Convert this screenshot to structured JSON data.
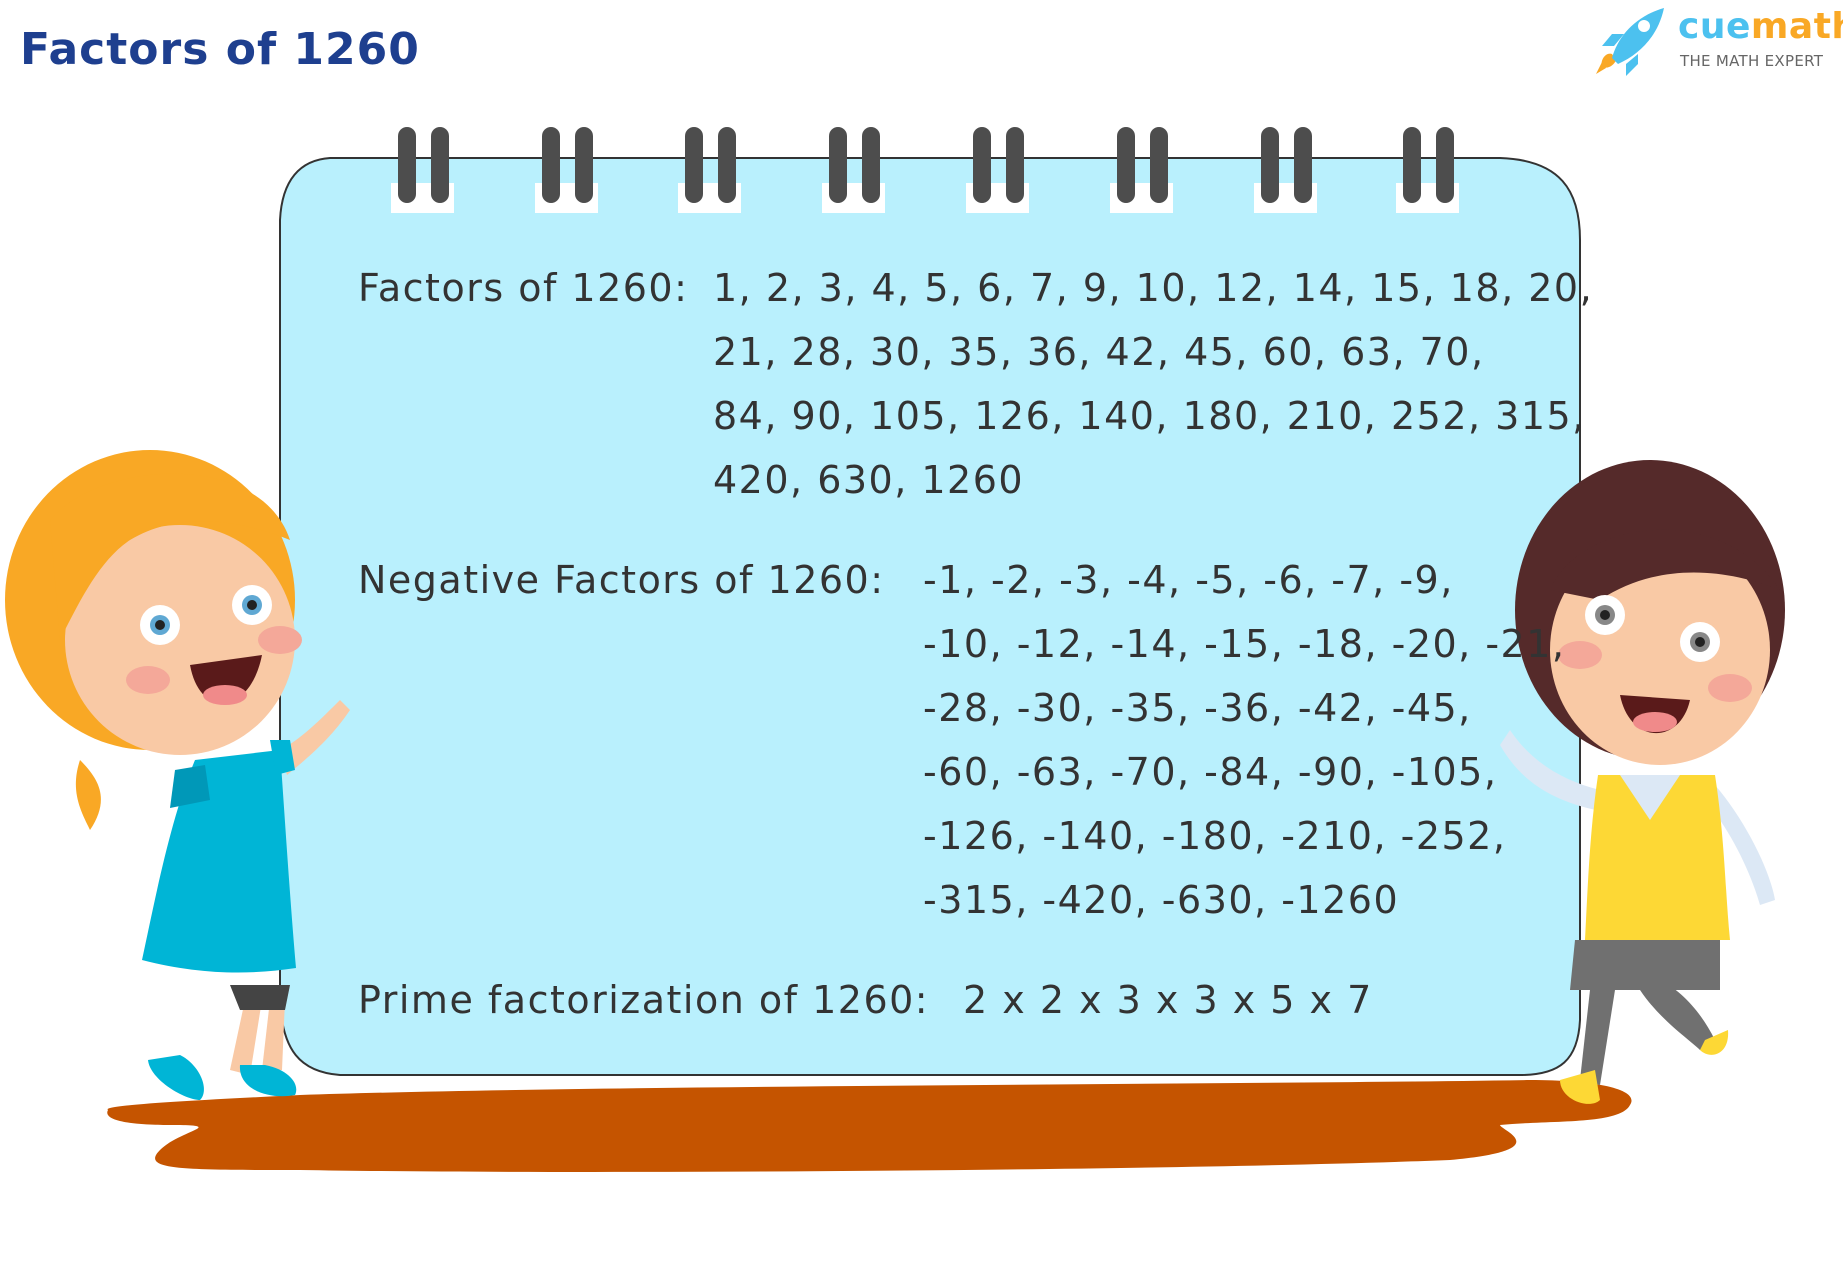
{
  "header": {
    "title": "Factors of 1260"
  },
  "logo": {
    "brand_part1": "cue",
    "brand_part2": "math",
    "tagline": "THE MATH EXPERT",
    "icon": "rocket-icon",
    "colors": {
      "cue": "#4cc1ef",
      "math": "#f9a825"
    }
  },
  "board": {
    "colors": {
      "fill": "#b9f0fd",
      "text": "#333333",
      "rings": "#4d4d4d",
      "puddle": "#c55400"
    },
    "factors": {
      "label": "Factors of 1260:",
      "lines": [
        "1, 2, 3, 4, 5, 6, 7, 9, 10, 12, 14, 15, 18, 20,",
        "21, 28, 30, 35, 36, 42, 45, 60, 63, 70,",
        "84, 90, 105, 126, 140, 180, 210, 252, 315,",
        "420, 630, 1260"
      ]
    },
    "negative_factors": {
      "label": "Negative Factors of 1260:",
      "lines": [
        "-1, -2, -3, -4, -5, -6, -7, -9,",
        "-10, -12, -14, -15, -18, -20, -21,",
        "-28, -30, -35, -36, -42, -45,",
        "-60, -63, -70, -84, -90, -105,",
        "-126, -140, -180, -210, -252,",
        "-315, -420, -630, -1260"
      ]
    },
    "prime_factorization": {
      "label": "Prime factorization of 1260:",
      "value": "2 x 2 x 3 x 3 x 5 x 7"
    }
  },
  "illustrations": {
    "left": "girl-character",
    "right": "boy-character"
  }
}
